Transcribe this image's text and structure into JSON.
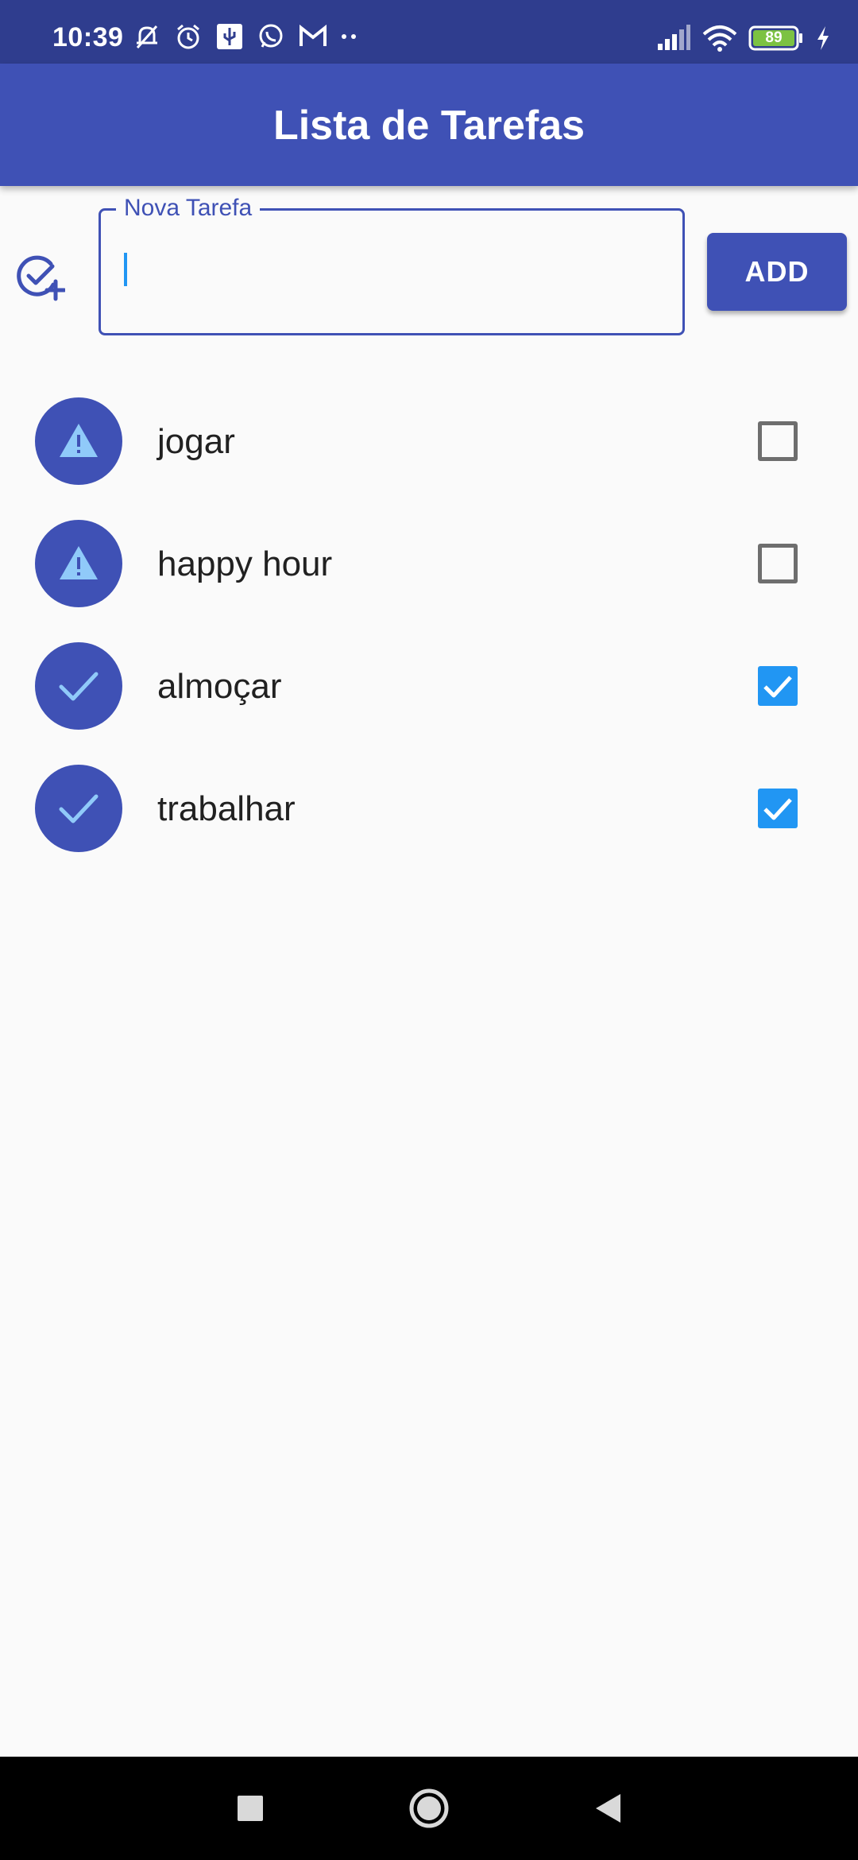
{
  "status_bar": {
    "time": "10:39",
    "battery": "89"
  },
  "app_bar": {
    "title": "Lista de Tarefas"
  },
  "new_task": {
    "label": "Nova Tarefa",
    "value": "",
    "add_button": "ADD"
  },
  "tasks": [
    {
      "label": "jogar",
      "done": false,
      "icon": "warning-icon"
    },
    {
      "label": "happy hour",
      "done": false,
      "icon": "warning-icon"
    },
    {
      "label": "almoçar",
      "done": true,
      "icon": "check-icon"
    },
    {
      "label": "trabalhar",
      "done": true,
      "icon": "check-icon"
    }
  ],
  "colors": {
    "primary": "#3f51b5",
    "status_bar": "#2f3d8e",
    "checkbox_checked": "#2196f3",
    "icon_tint": "#90caf9",
    "background": "#fafafa"
  }
}
